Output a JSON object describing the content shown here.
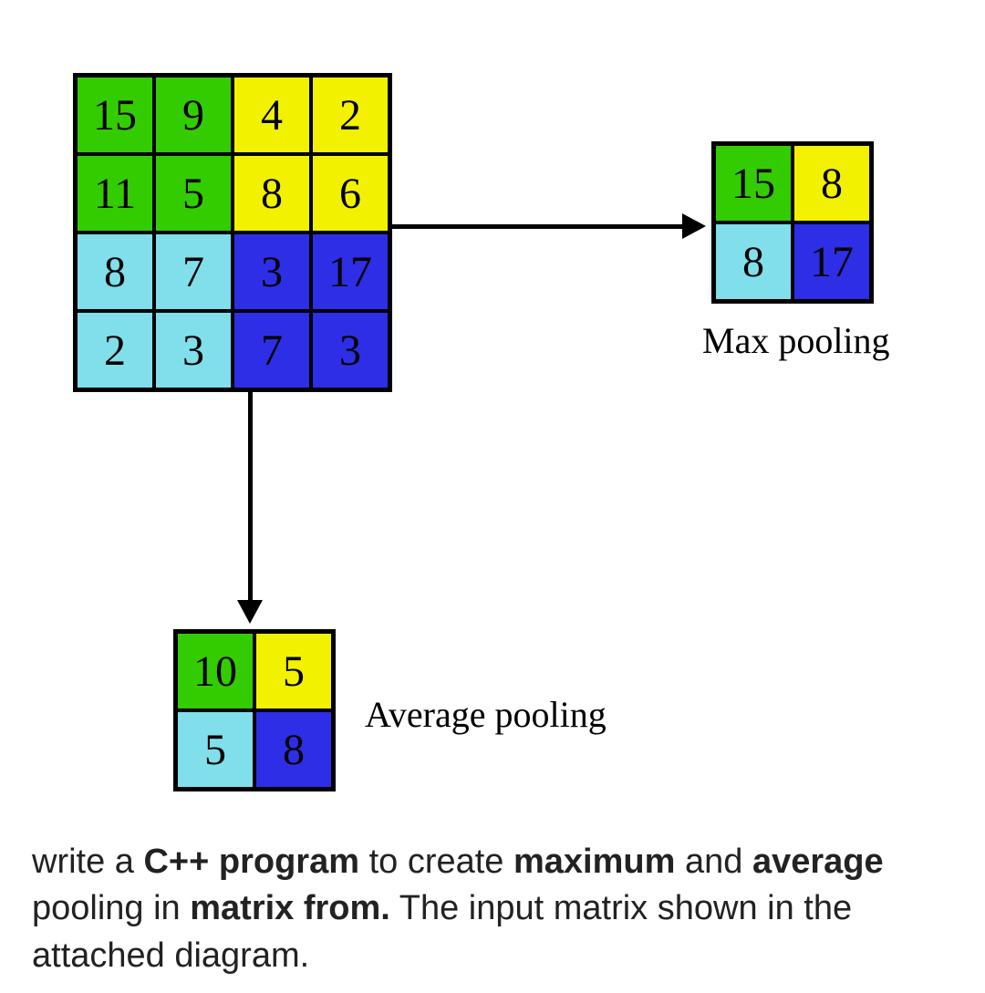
{
  "colors": {
    "green": "#33cc00",
    "yellow": "#f2f200",
    "cyan": "#80dfeb",
    "blue": "#2e2ee6"
  },
  "input_matrix": {
    "rows": 4,
    "cols": 4,
    "cells": [
      {
        "v": "15",
        "c": "green"
      },
      {
        "v": "9",
        "c": "green"
      },
      {
        "v": "4",
        "c": "yellow"
      },
      {
        "v": "2",
        "c": "yellow"
      },
      {
        "v": "11",
        "c": "green"
      },
      {
        "v": "5",
        "c": "green"
      },
      {
        "v": "8",
        "c": "yellow"
      },
      {
        "v": "6",
        "c": "yellow"
      },
      {
        "v": "8",
        "c": "cyan"
      },
      {
        "v": "7",
        "c": "cyan"
      },
      {
        "v": "3",
        "c": "blue"
      },
      {
        "v": "17",
        "c": "blue"
      },
      {
        "v": "2",
        "c": "cyan"
      },
      {
        "v": "3",
        "c": "cyan"
      },
      {
        "v": "7",
        "c": "blue"
      },
      {
        "v": "3",
        "c": "blue"
      }
    ]
  },
  "max_pool": {
    "rows": 2,
    "cols": 2,
    "cells": [
      {
        "v": "15",
        "c": "green"
      },
      {
        "v": "8",
        "c": "yellow"
      },
      {
        "v": "8",
        "c": "cyan"
      },
      {
        "v": "17",
        "c": "blue"
      }
    ]
  },
  "avg_pool": {
    "rows": 2,
    "cols": 2,
    "cells": [
      {
        "v": "10",
        "c": "green"
      },
      {
        "v": "5",
        "c": "yellow"
      },
      {
        "v": "5",
        "c": "cyan"
      },
      {
        "v": "8",
        "c": "blue"
      }
    ]
  },
  "labels": {
    "max": "Max pooling",
    "avg": "Average pooling"
  },
  "caption": {
    "t1": "write a ",
    "b1": "C++ program",
    "t2": " to create ",
    "b2": "maximum",
    "t3": " and ",
    "b3": "average",
    "t4": " pooling in ",
    "b4": "matrix from.",
    "t5": " The input matrix shown in the attached diagram."
  },
  "chart_data": {
    "type": "table",
    "description": "2x2 max-pooling and 2x2 average-pooling (stride 2) over a 4x4 input matrix",
    "input": [
      [
        15,
        9,
        4,
        2
      ],
      [
        11,
        5,
        8,
        6
      ],
      [
        8,
        7,
        3,
        17
      ],
      [
        2,
        3,
        7,
        3
      ]
    ],
    "max_pooling_output": [
      [
        15,
        8
      ],
      [
        8,
        17
      ]
    ],
    "average_pooling_output": [
      [
        10,
        5
      ],
      [
        5,
        8
      ]
    ],
    "quadrant_colors": {
      "top_left": "green",
      "top_right": "yellow",
      "bottom_left": "cyan",
      "bottom_right": "blue"
    }
  }
}
